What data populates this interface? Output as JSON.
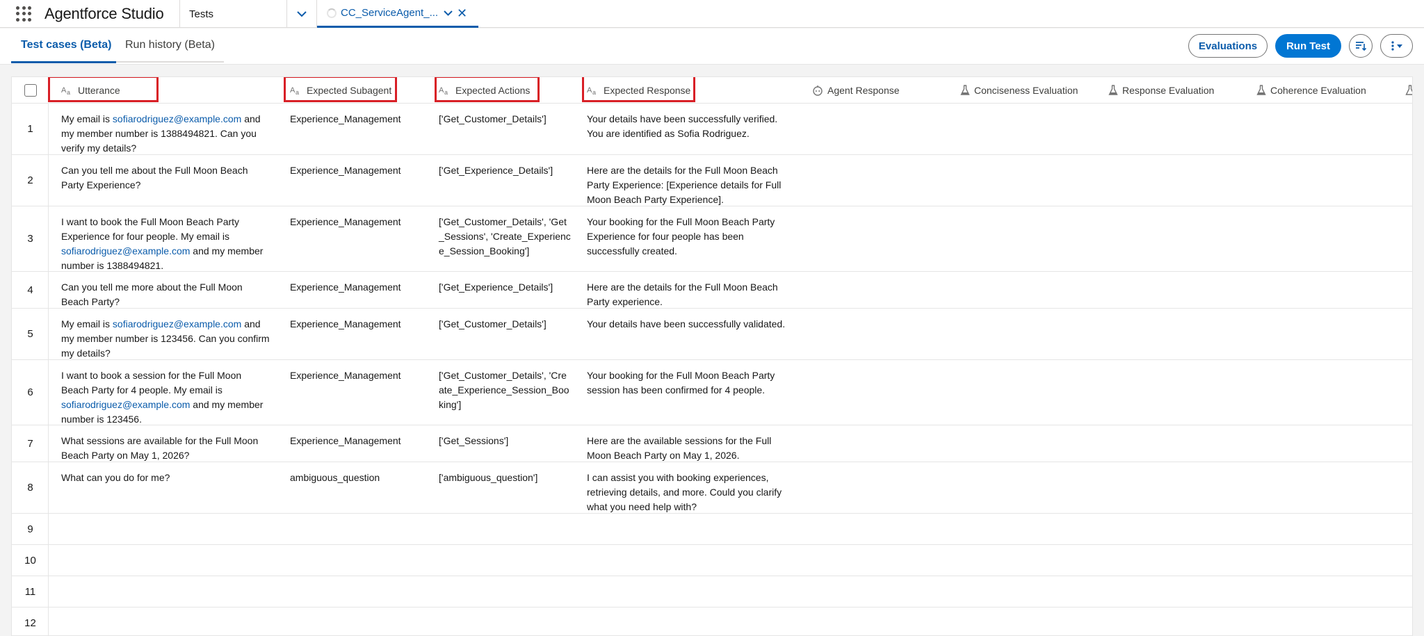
{
  "app": {
    "title": "Agentforce Studio"
  },
  "nav": {
    "item": "Tests",
    "active_tab": "CC_ServiceAgent_...",
    "close_glyph": "✕"
  },
  "subtabs": [
    {
      "label": "Test cases (Beta)"
    },
    {
      "label": "Run history (Beta)"
    }
  ],
  "actions": {
    "evaluations": "Evaluations",
    "run_test": "Run Test"
  },
  "columns": [
    {
      "label": "Utterance",
      "icon": "text-type-icon"
    },
    {
      "label": "Expected Subagent",
      "icon": "text-type-icon"
    },
    {
      "label": "Expected Actions",
      "icon": "text-type-icon"
    },
    {
      "label": "Expected Response",
      "icon": "text-type-icon"
    },
    {
      "label": "Agent Response",
      "icon": "agent-icon"
    },
    {
      "label": "Conciseness Evaluation",
      "icon": "flask-icon"
    },
    {
      "label": "Response Evaluation",
      "icon": "flask-icon"
    },
    {
      "label": "Coherence Evaluation",
      "icon": "flask-icon"
    }
  ],
  "rows": [
    {
      "num": "1",
      "utt": {
        "pre": "My email is ",
        "link": "sofiarodriguez@example.com",
        "post": " and my member number is 1388494821. Can you verify my details?"
      },
      "sub": "Experience_Management",
      "act": "['Get_Customer_Details']",
      "res": "Your details have been successfully verified. You are identified as Sofia Rodriguez."
    },
    {
      "num": "2",
      "utt": {
        "pre": "Can you tell me about the Full Moon Beach Party Experience?",
        "link": "",
        "post": ""
      },
      "sub": "Experience_Management",
      "act": "['Get_Experience_Details']",
      "res": "Here are the details for the Full Moon Beach Party Experience: [Experience details for Full Moon Beach Party Experience]."
    },
    {
      "num": "3",
      "utt": {
        "pre": "I want to book the Full Moon Beach Party Experience for four people. My email is ",
        "link": "sofiarodriguez@example.com",
        "post": " and my member number is 1388494821."
      },
      "sub": "Experience_Management",
      "act": "['Get_Customer_Details', 'Get_Sessions', 'Create_Experience_Session_Booking']",
      "res": "Your booking for the Full Moon Beach Party Experience for four people has been successfully created."
    },
    {
      "num": "4",
      "utt": {
        "pre": "Can you tell me more about the Full Moon Beach Party?",
        "link": "",
        "post": ""
      },
      "sub": "Experience_Management",
      "act": "['Get_Experience_Details']",
      "res": "Here are the details for the Full Moon Beach Party experience."
    },
    {
      "num": "5",
      "utt": {
        "pre": "My email is ",
        "link": "sofiarodriguez@example.com",
        "post": " and my member number is 123456. Can you confirm my details?"
      },
      "sub": "Experience_Management",
      "act": "['Get_Customer_Details']",
      "res": "Your details have been successfully validated."
    },
    {
      "num": "6",
      "utt": {
        "pre": "I want to book a session for the Full Moon Beach Party for 4 people. My email is ",
        "link": "sofiarodriguez@example.com",
        "post": " and my member number is 123456."
      },
      "sub": "Experience_Management",
      "act": "['Get_Customer_Details', 'Create_Experience_Session_Booking']",
      "res": "Your booking for the Full Moon Beach Party session has been confirmed for 4 people."
    },
    {
      "num": "7",
      "utt": {
        "pre": "What sessions are available for the Full Moon Beach Party on May 1, 2026?",
        "link": "",
        "post": ""
      },
      "sub": "Experience_Management",
      "act": "['Get_Sessions']",
      "res": "Here are the available sessions for the Full Moon Beach Party on May 1, 2026."
    },
    {
      "num": "8",
      "utt": {
        "pre": "What can you do for me?",
        "link": "",
        "post": ""
      },
      "sub": "ambiguous_question",
      "act": "['ambiguous_question']",
      "res": "I can assist you with booking experiences, retrieving details, and more. Could you clarify what you need help with?"
    },
    {
      "num": "9",
      "utt": {
        "pre": "",
        "link": "",
        "post": ""
      },
      "sub": "",
      "act": "",
      "res": ""
    },
    {
      "num": "10",
      "utt": {
        "pre": "",
        "link": "",
        "post": ""
      },
      "sub": "",
      "act": "",
      "res": ""
    },
    {
      "num": "11",
      "utt": {
        "pre": "",
        "link": "",
        "post": ""
      },
      "sub": "",
      "act": "",
      "res": ""
    },
    {
      "num": "12",
      "utt": {
        "pre": "",
        "link": "",
        "post": ""
      },
      "sub": "",
      "act": "",
      "res": ""
    }
  ],
  "colors": {
    "accent": "#0b5cab",
    "brand_button": "#0176d3",
    "highlight_box": "#d81f26"
  }
}
